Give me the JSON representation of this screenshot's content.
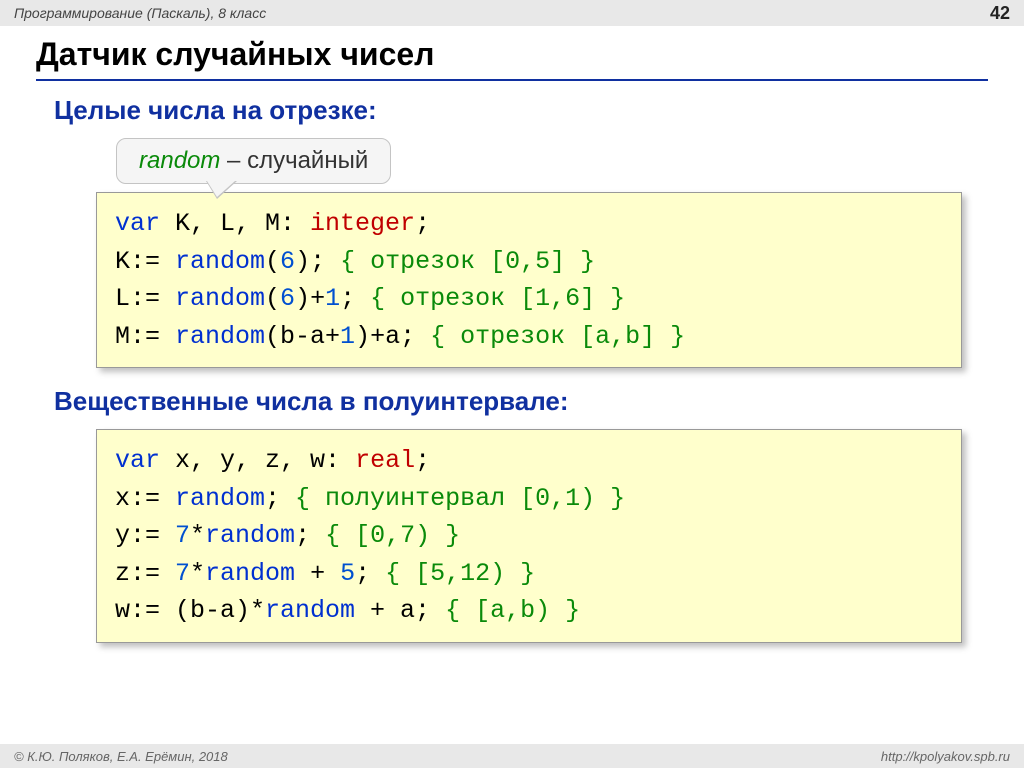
{
  "header": {
    "course": "Программирование (Паскаль), 8 класс",
    "page": "42"
  },
  "title": "Датчик случайных чисел",
  "section1": "Целые числа на отрезке:",
  "tooltip": {
    "term": "random",
    "dash": " – ",
    "def": "случайный"
  },
  "code1": {
    "l1a": "var",
    "l1b": " K, L, M: ",
    "l1c": "integer",
    "l1d": ";",
    "l2a": "K:= ",
    "l2b": "random",
    "l2c": "(",
    "l2n": "6",
    "l2d": ");   ",
    "l2e": "{ отрезок [0,5] }",
    "l3a": "L:= ",
    "l3b": "random",
    "l3c": "(",
    "l3n": "6",
    "l3d": ")+",
    "l3n2": "1",
    "l3e": "; ",
    "l3f": "{ отрезок [1,6] }",
    "l4a": "M:= ",
    "l4b": "random",
    "l4c": "(b-a+",
    "l4n": "1",
    "l4d": ")+a; ",
    "l4e": "{ отрезок [a,b] }"
  },
  "section2": "Вещественные числа в полуинтервале:",
  "code2": {
    "l1a": "var",
    "l1b": " x, y, z, w: ",
    "l1c": "real",
    "l1d": ";",
    "l2a": "x:= ",
    "l2b": "random",
    "l2c": "; ",
    "l2d": "{ полуинтервал [0,1) }",
    "l3a": "y:= ",
    "l3n": "7",
    "l3b": "*",
    "l3c": "random",
    "l3d": "; ",
    "l3e": "{ [0,7) }",
    "l4a": "z:= ",
    "l4n": "7",
    "l4b": "*",
    "l4c": "random",
    "l4d": " + ",
    "l4n2": "5",
    "l4e": "; ",
    "l4f": "{ [5,12) }",
    "l5a": "w:= (b-a)*",
    "l5b": "random",
    "l5c": " + a; ",
    "l5d": "{ [a,b) }"
  },
  "footer": {
    "authors": "© К.Ю. Поляков, Е.А. Ерёмин, 2018",
    "url": "http://kpolyakov.spb.ru"
  }
}
